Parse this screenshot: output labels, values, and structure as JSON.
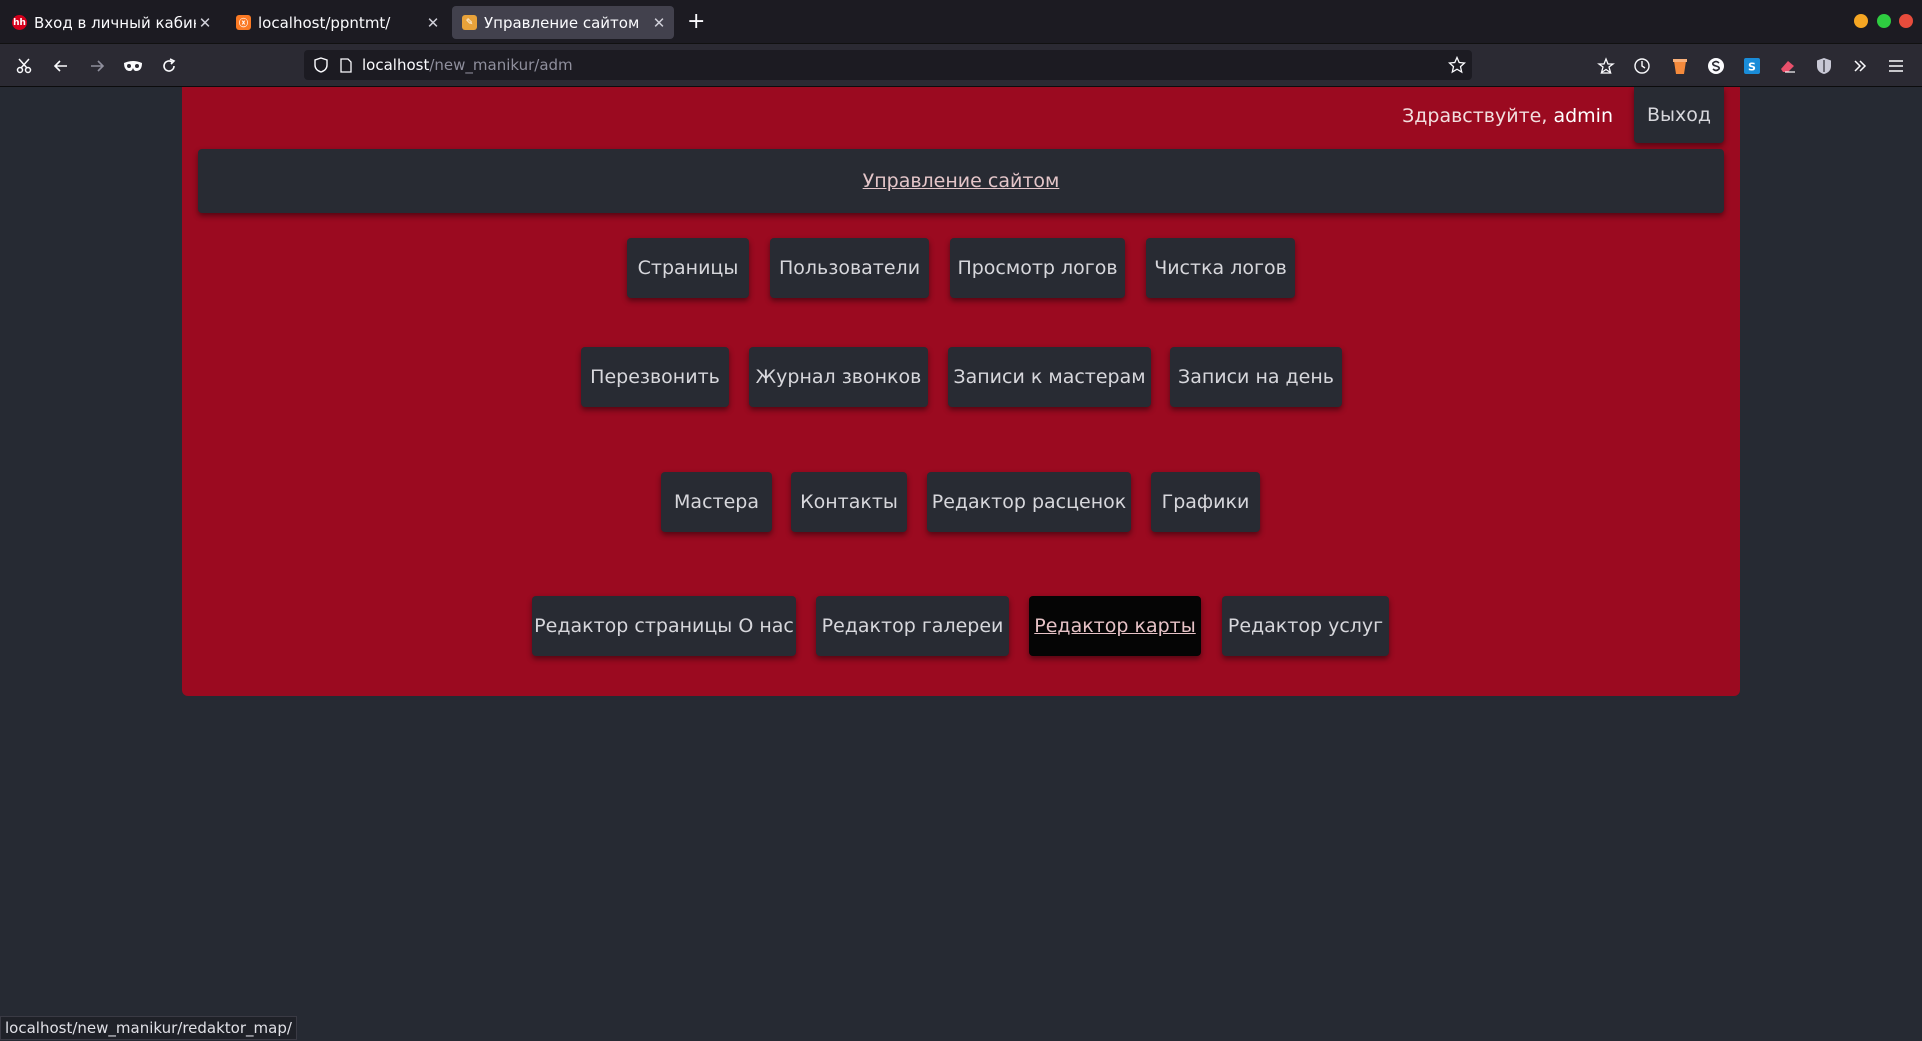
{
  "browser": {
    "tabs": [
      {
        "title": "Вход в личный кабин",
        "favicon": "hh-icon",
        "favicon_text": "hh",
        "favicon_color": "#d6001c"
      },
      {
        "title": "localhost/ppntmt/",
        "favicon": "xampp-icon",
        "favicon_color": "#fb7a24"
      },
      {
        "title": "Управление сайтом",
        "favicon": "site-icon",
        "favicon_color": "#e8a23a"
      }
    ],
    "url_host": "localhost",
    "url_path": "/new_manikur/adm",
    "window_colors": {
      "minimize": "#f5a623",
      "maximize": "#2ecc40",
      "close": "#e74c3c"
    }
  },
  "page": {
    "greeting_prefix": "Здравствуйте, ",
    "username": "admin",
    "logout_label": "Выход",
    "header_link": "Управление сайтом",
    "rows": [
      [
        "Страницы",
        "Пользователи",
        "Просмотр логов",
        "Чистка логов"
      ],
      [
        "Перезвонить",
        "Журнал звонков",
        "Записи к мастерам",
        "Записи на день"
      ],
      [
        "Мастера",
        "Контакты",
        "Редактор расценок",
        "Графики"
      ],
      [
        "Редактор страницы О нас",
        "Редактор галереи",
        "Редактор карты",
        "Редактор услуг"
      ]
    ],
    "current_item": "Редактор карты",
    "colors": {
      "panel": "#9b0a20",
      "button": "#282b33",
      "background": "#262a33"
    }
  },
  "status_url": "localhost/new_manikur/redaktor_map/"
}
